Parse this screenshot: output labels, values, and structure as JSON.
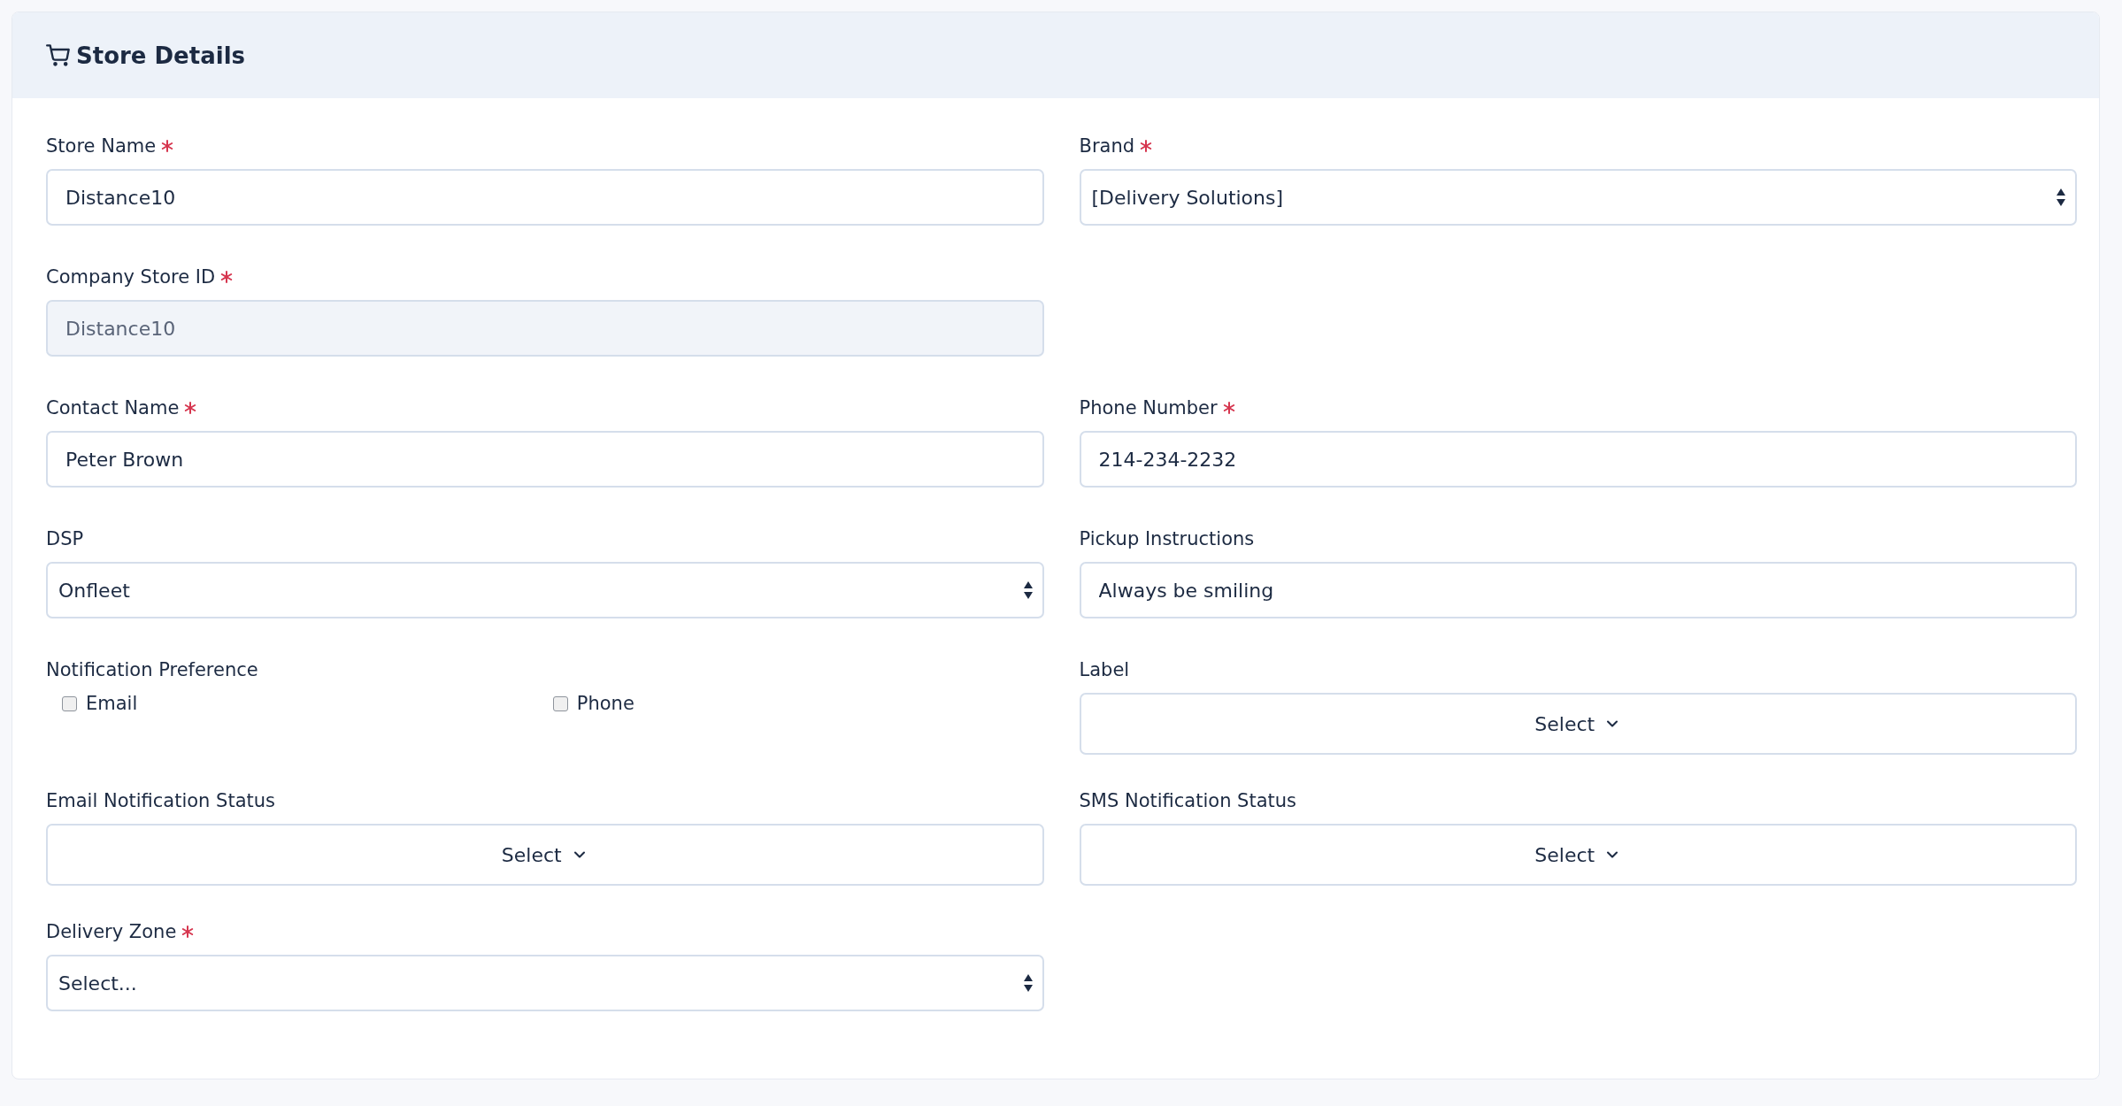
{
  "header": {
    "title": "Store Details"
  },
  "rows": [
    {
      "fields": [
        {
          "kind": "text",
          "label": "Store Name",
          "required": true,
          "value": "Distance10",
          "disabled": false
        },
        {
          "kind": "select",
          "label": "Brand",
          "required": true,
          "value": "[Delivery Solutions]"
        }
      ]
    },
    {
      "fields": [
        {
          "kind": "text",
          "label": "Company Store ID",
          "required": true,
          "value": "Distance10",
          "disabled": true
        }
      ]
    },
    {
      "fields": [
        {
          "kind": "text",
          "label": "Contact Name",
          "required": true,
          "value": "Peter Brown",
          "disabled": false
        },
        {
          "kind": "text",
          "label": "Phone Number",
          "required": true,
          "value": "214-234-2232",
          "disabled": false
        }
      ]
    },
    {
      "fields": [
        {
          "kind": "select",
          "label": "DSP",
          "required": false,
          "value": "Onfleet"
        },
        {
          "kind": "text",
          "label": "Pickup Instructions",
          "required": false,
          "value": "Always be smiling",
          "disabled": false
        }
      ]
    },
    {
      "fields": [
        {
          "kind": "checkboxes",
          "label": "Notification Preference",
          "required": false,
          "options": [
            {
              "label": "Email",
              "checked": false
            },
            {
              "label": "Phone",
              "checked": false
            }
          ]
        },
        {
          "kind": "dropdown",
          "label": "Label",
          "required": false,
          "button": "Select"
        }
      ]
    },
    {
      "fields": [
        {
          "kind": "dropdown",
          "label": "Email Notification Status",
          "required": false,
          "button": "Select"
        },
        {
          "kind": "dropdown",
          "label": "SMS Notification Status",
          "required": false,
          "button": "Select"
        }
      ]
    },
    {
      "fields": [
        {
          "kind": "select",
          "label": "Delivery Zone",
          "required": true,
          "value": "Select..."
        }
      ]
    }
  ]
}
